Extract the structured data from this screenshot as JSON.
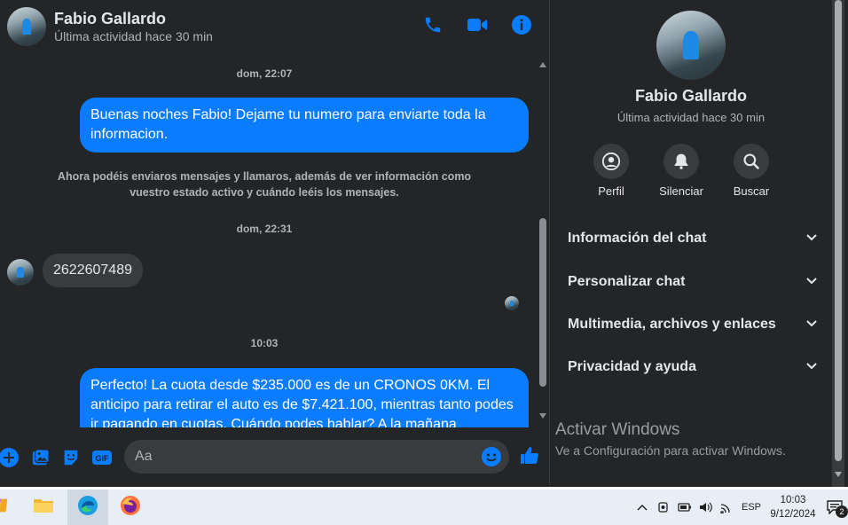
{
  "header": {
    "name": "Fabio Gallardo",
    "status": "Última actividad hace 30 min"
  },
  "messages": [
    {
      "type": "timestamp",
      "text": "dom, 22:07"
    },
    {
      "type": "outgoing",
      "text": "Buenas noches Fabio! Dejame tu numero para enviarte toda la informacion."
    },
    {
      "type": "notice",
      "text": "Ahora podéis enviaros mensajes y llamaros, además de ver información como vuestro estado activo y cuándo leéis los mensajes."
    },
    {
      "type": "timestamp",
      "text": "dom, 22:31"
    },
    {
      "type": "incoming",
      "text": "2622607489"
    },
    {
      "type": "timestamp",
      "text": "10:03"
    },
    {
      "type": "outgoing",
      "text": "Perfecto! La cuota desde $235.000 es de un CRONOS 0KM. El anticipo para retirar el auto es de $7.421.100, mientras tanto podes ir pagando en cuotas. Cuándo podes hablar? A la mañana"
    }
  ],
  "composer": {
    "placeholder": "Aa"
  },
  "panel": {
    "name": "Fabio Gallardo",
    "status": "Última actividad hace 30 min",
    "actions": [
      "Perfil",
      "Silenciar",
      "Buscar"
    ],
    "sections": [
      "Información del chat",
      "Personalizar chat",
      "Multimedia, archivos y enlaces",
      "Privacidad y ayuda"
    ]
  },
  "watermark": {
    "title": "Activar Windows",
    "subtitle": "Ve a Configuración para activar Windows."
  },
  "taskbar": {
    "lang": "ESP",
    "time": "10:03",
    "date": "9/12/2024",
    "notifications": "2"
  },
  "colors": {
    "accent": "#0a7cff",
    "background": "#242526",
    "bubble_in": "#3a3b3c"
  }
}
